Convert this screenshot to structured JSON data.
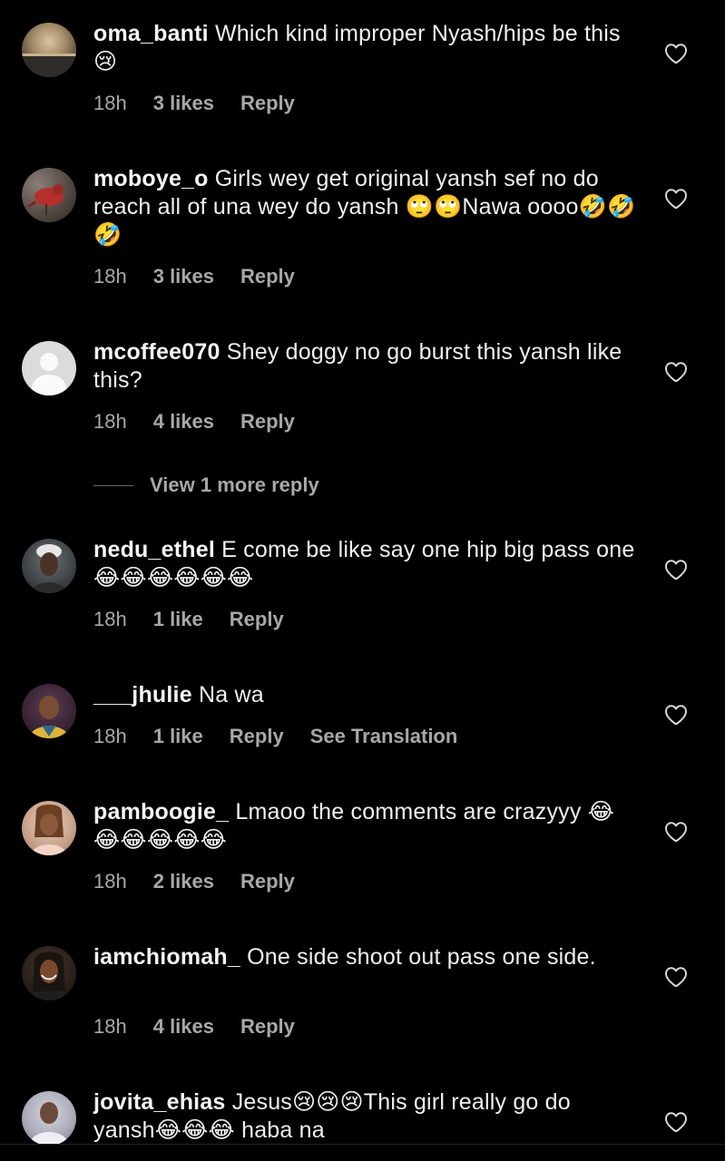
{
  "comments": [
    {
      "username": "oma_banti",
      "text": "Which kind improper  Nyash/hips be this😢",
      "time": "18h",
      "likes": "3 likes",
      "reply": "Reply"
    },
    {
      "username": "moboye_o",
      "text": "Girls wey get original yansh sef no do reach all of una wey do yansh 🙄🙄Nawa oooo🤣🤣🤣",
      "time": "18h",
      "likes": "3 likes",
      "reply": "Reply"
    },
    {
      "username": "mcoffee070",
      "text": "Shey doggy no go burst this yansh like this?",
      "time": "18h",
      "likes": "4 likes",
      "reply": "Reply"
    },
    {
      "username": "nedu_ethel",
      "text": "E come be like say one hip big pass one 😂😂😂😂😂😂",
      "time": "18h",
      "likes": "1 like",
      "reply": "Reply"
    },
    {
      "username": "___jhulie",
      "text": "Na wa",
      "time": "18h",
      "likes": "1 like",
      "reply": "Reply",
      "translate": "See Translation"
    },
    {
      "username": "pamboogie_",
      "text": "Lmaoo the comments are crazyyy 😂😂😂😂😂😂",
      "time": "18h",
      "likes": "2 likes",
      "reply": "Reply"
    },
    {
      "username": "iamchiomah_",
      "text": "One side shoot out pass one side.",
      "time": "18h",
      "likes": "4 likes",
      "reply": "Reply"
    },
    {
      "username": "jovita_ehias",
      "text": "Jesus😢😢😢This girl really go do yansh😂😂😂 haba na"
    }
  ],
  "view_more_replies": "View 1 more reply",
  "icons": {
    "heart": "heart-outline-icon",
    "default_avatar": "default-profile-icon"
  },
  "colors": {
    "background": "#000000",
    "text": "#f5f5f5",
    "meta": "#a8a8a8"
  }
}
